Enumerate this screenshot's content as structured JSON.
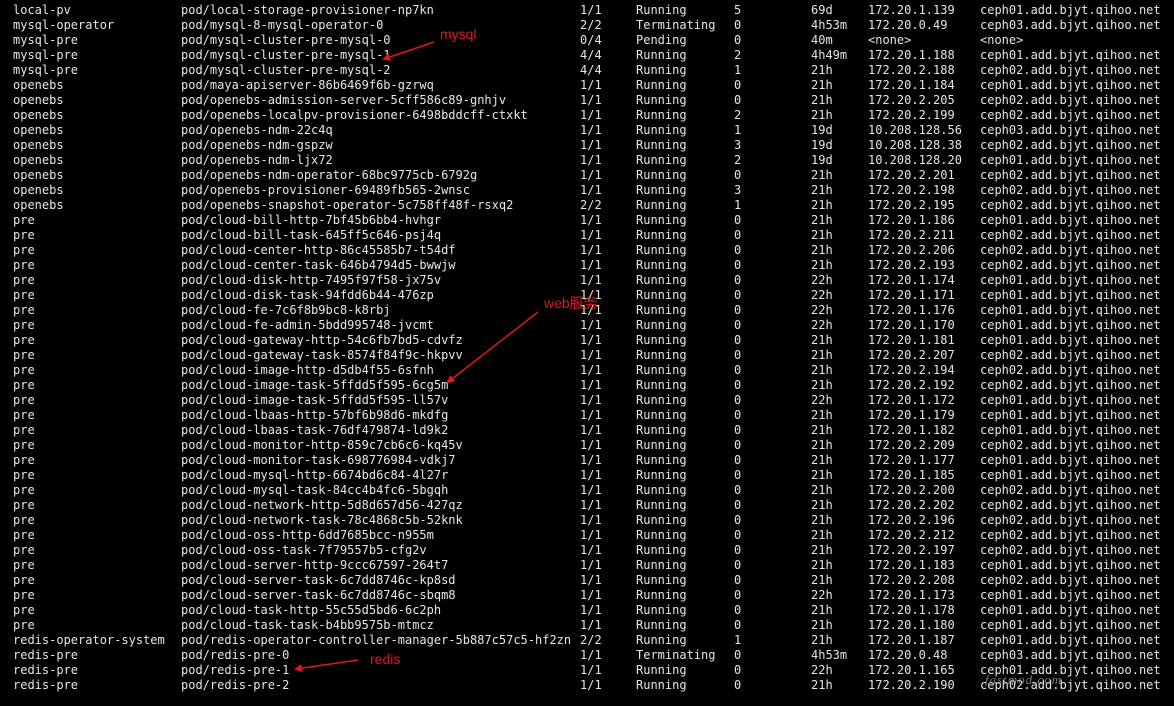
{
  "rows": [
    [
      "local-pv",
      "pod/local-storage-provisioner-np7kn",
      "1/1",
      "Running",
      "5",
      "69d",
      "172.20.1.139",
      "ceph01.add.bjyt.qihoo.net"
    ],
    [
      "mysql-operator",
      "pod/mysql-8-mysql-operator-0",
      "2/2",
      "Terminating",
      "0",
      "4h53m",
      "172.20.0.49",
      "ceph03.add.bjyt.qihoo.net"
    ],
    [
      "mysql-pre",
      "pod/mysql-cluster-pre-mysql-0",
      "0/4",
      "Pending",
      "0",
      "40m",
      "<none>",
      "<none>"
    ],
    [
      "mysql-pre",
      "pod/mysql-cluster-pre-mysql-1",
      "4/4",
      "Running",
      "2",
      "4h49m",
      "172.20.1.188",
      "ceph01.add.bjyt.qihoo.net"
    ],
    [
      "mysql-pre",
      "pod/mysql-cluster-pre-mysql-2",
      "4/4",
      "Running",
      "1",
      "21h",
      "172.20.2.188",
      "ceph02.add.bjyt.qihoo.net"
    ],
    [
      "openebs",
      "pod/maya-apiserver-86b6469f6b-gzrwq",
      "1/1",
      "Running",
      "0",
      "21h",
      "172.20.1.184",
      "ceph01.add.bjyt.qihoo.net"
    ],
    [
      "openebs",
      "pod/openebs-admission-server-5cff586c89-gnhjv",
      "1/1",
      "Running",
      "0",
      "21h",
      "172.20.2.205",
      "ceph02.add.bjyt.qihoo.net"
    ],
    [
      "openebs",
      "pod/openebs-localpv-provisioner-6498bddcff-ctxkt",
      "1/1",
      "Running",
      "2",
      "21h",
      "172.20.2.199",
      "ceph02.add.bjyt.qihoo.net"
    ],
    [
      "openebs",
      "pod/openebs-ndm-22c4q",
      "1/1",
      "Running",
      "1",
      "19d",
      "10.208.128.56",
      "ceph03.add.bjyt.qihoo.net"
    ],
    [
      "openebs",
      "pod/openebs-ndm-gspzw",
      "1/1",
      "Running",
      "3",
      "19d",
      "10.208.128.38",
      "ceph02.add.bjyt.qihoo.net"
    ],
    [
      "openebs",
      "pod/openebs-ndm-ljx72",
      "1/1",
      "Running",
      "2",
      "19d",
      "10.208.128.20",
      "ceph01.add.bjyt.qihoo.net"
    ],
    [
      "openebs",
      "pod/openebs-ndm-operator-68bc9775cb-6792g",
      "1/1",
      "Running",
      "0",
      "21h",
      "172.20.2.201",
      "ceph02.add.bjyt.qihoo.net"
    ],
    [
      "openebs",
      "pod/openebs-provisioner-69489fb565-2wnsc",
      "1/1",
      "Running",
      "3",
      "21h",
      "172.20.2.198",
      "ceph02.add.bjyt.qihoo.net"
    ],
    [
      "openebs",
      "pod/openebs-snapshot-operator-5c758ff48f-rsxq2",
      "2/2",
      "Running",
      "1",
      "21h",
      "172.20.2.195",
      "ceph02.add.bjyt.qihoo.net"
    ],
    [
      "pre",
      "pod/cloud-bill-http-7bf45b6bb4-hvhgr",
      "1/1",
      "Running",
      "0",
      "21h",
      "172.20.1.186",
      "ceph01.add.bjyt.qihoo.net"
    ],
    [
      "pre",
      "pod/cloud-bill-task-645ff5c646-psj4q",
      "1/1",
      "Running",
      "0",
      "21h",
      "172.20.2.211",
      "ceph02.add.bjyt.qihoo.net"
    ],
    [
      "pre",
      "pod/cloud-center-http-86c45585b7-t54df",
      "1/1",
      "Running",
      "0",
      "21h",
      "172.20.2.206",
      "ceph02.add.bjyt.qihoo.net"
    ],
    [
      "pre",
      "pod/cloud-center-task-646b4794d5-bwwjw",
      "1/1",
      "Running",
      "0",
      "21h",
      "172.20.2.193",
      "ceph02.add.bjyt.qihoo.net"
    ],
    [
      "pre",
      "pod/cloud-disk-http-7495f97f58-jx75v",
      "1/1",
      "Running",
      "0",
      "22h",
      "172.20.1.174",
      "ceph01.add.bjyt.qihoo.net"
    ],
    [
      "pre",
      "pod/cloud-disk-task-94fdd6b44-476zp",
      "1/1",
      "Running",
      "0",
      "22h",
      "172.20.1.171",
      "ceph01.add.bjyt.qihoo.net"
    ],
    [
      "pre",
      "pod/cloud-fe-7c6f8b9bc8-k8rbj",
      "1/1",
      "Running",
      "0",
      "22h",
      "172.20.1.176",
      "ceph01.add.bjyt.qihoo.net"
    ],
    [
      "pre",
      "pod/cloud-fe-admin-5bdd995748-jvcmt",
      "1/1",
      "Running",
      "0",
      "22h",
      "172.20.1.170",
      "ceph01.add.bjyt.qihoo.net"
    ],
    [
      "pre",
      "pod/cloud-gateway-http-54c6fb7bd5-cdvfz",
      "1/1",
      "Running",
      "0",
      "21h",
      "172.20.1.181",
      "ceph01.add.bjyt.qihoo.net"
    ],
    [
      "pre",
      "pod/cloud-gateway-task-8574f84f9c-hkpvv",
      "1/1",
      "Running",
      "0",
      "21h",
      "172.20.2.207",
      "ceph02.add.bjyt.qihoo.net"
    ],
    [
      "pre",
      "pod/cloud-image-http-d5db4f55-6sfnh",
      "1/1",
      "Running",
      "0",
      "21h",
      "172.20.2.194",
      "ceph02.add.bjyt.qihoo.net"
    ],
    [
      "pre",
      "pod/cloud-image-task-5ffdd5f595-6cg5m",
      "1/1",
      "Running",
      "0",
      "21h",
      "172.20.2.192",
      "ceph02.add.bjyt.qihoo.net"
    ],
    [
      "pre",
      "pod/cloud-image-task-5ffdd5f595-ll57v",
      "1/1",
      "Running",
      "0",
      "22h",
      "172.20.1.172",
      "ceph01.add.bjyt.qihoo.net"
    ],
    [
      "pre",
      "pod/cloud-lbaas-http-57bf6b98d6-mkdfg",
      "1/1",
      "Running",
      "0",
      "21h",
      "172.20.1.179",
      "ceph01.add.bjyt.qihoo.net"
    ],
    [
      "pre",
      "pod/cloud-lbaas-task-76df479874-ld9k2",
      "1/1",
      "Running",
      "0",
      "21h",
      "172.20.1.182",
      "ceph01.add.bjyt.qihoo.net"
    ],
    [
      "pre",
      "pod/cloud-monitor-http-859c7cb6c6-kq45v",
      "1/1",
      "Running",
      "0",
      "21h",
      "172.20.2.209",
      "ceph02.add.bjyt.qihoo.net"
    ],
    [
      "pre",
      "pod/cloud-monitor-task-698776984-vdkj7",
      "1/1",
      "Running",
      "0",
      "21h",
      "172.20.1.177",
      "ceph01.add.bjyt.qihoo.net"
    ],
    [
      "pre",
      "pod/cloud-mysql-http-6674bd6c84-4l27r",
      "1/1",
      "Running",
      "0",
      "21h",
      "172.20.1.185",
      "ceph01.add.bjyt.qihoo.net"
    ],
    [
      "pre",
      "pod/cloud-mysql-task-84cc4b4fc6-5bgqh",
      "1/1",
      "Running",
      "0",
      "21h",
      "172.20.2.200",
      "ceph02.add.bjyt.qihoo.net"
    ],
    [
      "pre",
      "pod/cloud-network-http-5d8d657d56-427qz",
      "1/1",
      "Running",
      "0",
      "21h",
      "172.20.2.202",
      "ceph02.add.bjyt.qihoo.net"
    ],
    [
      "pre",
      "pod/cloud-network-task-78c4868c5b-52knk",
      "1/1",
      "Running",
      "0",
      "21h",
      "172.20.2.196",
      "ceph02.add.bjyt.qihoo.net"
    ],
    [
      "pre",
      "pod/cloud-oss-http-6dd7685bcc-n955m",
      "1/1",
      "Running",
      "0",
      "21h",
      "172.20.2.212",
      "ceph02.add.bjyt.qihoo.net"
    ],
    [
      "pre",
      "pod/cloud-oss-task-7f79557b5-cfg2v",
      "1/1",
      "Running",
      "0",
      "21h",
      "172.20.2.197",
      "ceph02.add.bjyt.qihoo.net"
    ],
    [
      "pre",
      "pod/cloud-server-http-9ccc67597-264t7",
      "1/1",
      "Running",
      "0",
      "21h",
      "172.20.1.183",
      "ceph01.add.bjyt.qihoo.net"
    ],
    [
      "pre",
      "pod/cloud-server-task-6c7dd8746c-kp8sd",
      "1/1",
      "Running",
      "0",
      "21h",
      "172.20.2.208",
      "ceph02.add.bjyt.qihoo.net"
    ],
    [
      "pre",
      "pod/cloud-server-task-6c7dd8746c-sbqm8",
      "1/1",
      "Running",
      "0",
      "22h",
      "172.20.1.173",
      "ceph01.add.bjyt.qihoo.net"
    ],
    [
      "pre",
      "pod/cloud-task-http-55c55d5bd6-6c2ph",
      "1/1",
      "Running",
      "0",
      "21h",
      "172.20.1.178",
      "ceph01.add.bjyt.qihoo.net"
    ],
    [
      "pre",
      "pod/cloud-task-task-b4bb9575b-mtmcz",
      "1/1",
      "Running",
      "0",
      "21h",
      "172.20.1.180",
      "ceph01.add.bjyt.qihoo.net"
    ],
    [
      "redis-operator-system",
      "pod/redis-operator-controller-manager-5b887c57c5-hf2zn",
      "2/2",
      "Running",
      "1",
      "21h",
      "172.20.1.187",
      "ceph01.add.bjyt.qihoo.net"
    ],
    [
      "redis-pre",
      "pod/redis-pre-0",
      "1/1",
      "Terminating",
      "0",
      "4h53m",
      "172.20.0.48",
      "ceph03.add.bjyt.qihoo.net"
    ],
    [
      "redis-pre",
      "pod/redis-pre-1",
      "1/1",
      "Running",
      "0",
      "22h",
      "172.20.1.165",
      "ceph01.add.bjyt.qihoo.net"
    ],
    [
      "redis-pre",
      "pod/redis-pre-2",
      "1/1",
      "Running",
      "0",
      "21h",
      "172.20.2.190",
      "ceph02.add.bjyt.qihoo.net"
    ]
  ],
  "annotations": {
    "mysql": "mysql",
    "web": "web服务",
    "redis": "redis"
  },
  "watermark": "fastmod.com",
  "colors": {
    "background": "#000000",
    "text": "#e6e6e6",
    "annotation": "#e0191c"
  }
}
